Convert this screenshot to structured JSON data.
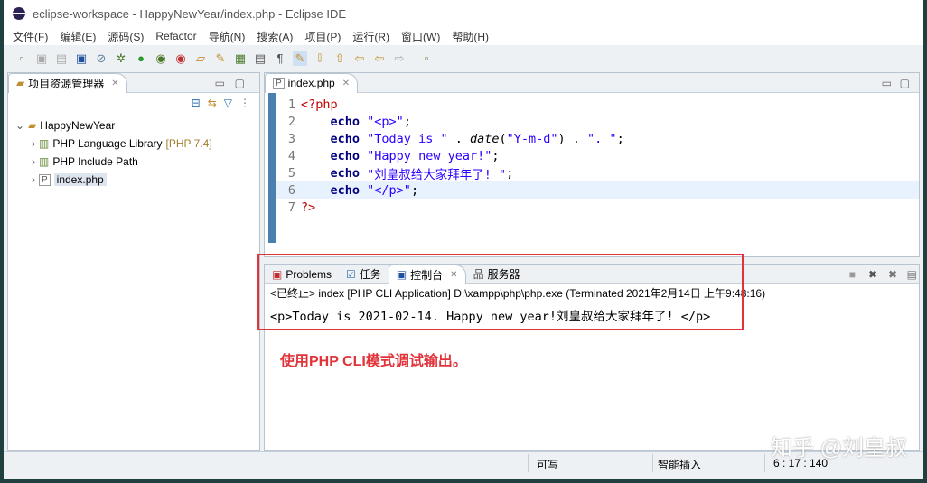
{
  "title": "eclipse-workspace - HappyNewYear/index.php - Eclipse IDE",
  "menu": [
    "文件(F)",
    "编辑(E)",
    "源码(S)",
    "Refactor",
    "导航(N)",
    "搜索(A)",
    "项目(P)",
    "运行(R)",
    "窗口(W)",
    "帮助(H)"
  ],
  "explorer": {
    "tab": "项目资源管理器",
    "project": "HappyNewYear",
    "items": [
      {
        "label": "PHP Language Library",
        "extra": "[PHP 7.4]"
      },
      {
        "label": "PHP Include Path",
        "extra": ""
      },
      {
        "label": "index.php",
        "extra": ""
      }
    ]
  },
  "editor": {
    "tab": "index.php",
    "lines": [
      {
        "n": "1",
        "parts": [
          [
            "php",
            "<?php"
          ]
        ]
      },
      {
        "n": "2",
        "parts": [
          [
            "",
            "    "
          ],
          [
            "kw",
            "echo"
          ],
          [
            "",
            " "
          ],
          [
            "str",
            "\"<p>\""
          ],
          [
            "",
            ";"
          ]
        ]
      },
      {
        "n": "3",
        "parts": [
          [
            "",
            "    "
          ],
          [
            "kw",
            "echo"
          ],
          [
            "",
            " "
          ],
          [
            "str",
            "\"Today is \""
          ],
          [
            "",
            " . "
          ],
          [
            "fn",
            "date"
          ],
          [
            "",
            "("
          ],
          [
            "str",
            "\"Y-m-d\""
          ],
          [
            "",
            ") . "
          ],
          [
            "str",
            "\". \""
          ],
          [
            "",
            ";"
          ]
        ]
      },
      {
        "n": "4",
        "parts": [
          [
            "",
            "    "
          ],
          [
            "kw",
            "echo"
          ],
          [
            "",
            " "
          ],
          [
            "str",
            "\"Happy new year!\""
          ],
          [
            "",
            ";"
          ]
        ]
      },
      {
        "n": "5",
        "parts": [
          [
            "",
            "    "
          ],
          [
            "kw",
            "echo"
          ],
          [
            "",
            " "
          ],
          [
            "str",
            "\"刘皇叔给大家拜年了! \""
          ],
          [
            "",
            ";"
          ]
        ]
      },
      {
        "n": "6",
        "parts": [
          [
            "",
            "    "
          ],
          [
            "kw",
            "echo"
          ],
          [
            "",
            " "
          ],
          [
            "str",
            "\"</p>\""
          ],
          [
            "",
            ";"
          ]
        ]
      },
      {
        "n": "7",
        "parts": [
          [
            "php",
            "?>"
          ]
        ]
      }
    ]
  },
  "console": {
    "tabs": [
      "Problems",
      "任务",
      "控制台",
      "服务器"
    ],
    "header": "<已终止> index [PHP CLI Application] D:\\xampp\\php\\php.exe (Terminated 2021年2月14日 上午9:48:16)",
    "output": "<p>Today is 2021-02-14. Happy new year!刘皇叔给大家拜年了! </p>"
  },
  "annotation": "使用PHP CLI模式调试输出。",
  "status": {
    "writable": "可写",
    "insert": "智能插入",
    "position": "6 : 17 : 140"
  },
  "watermark": "知乎 @刘皇叔"
}
